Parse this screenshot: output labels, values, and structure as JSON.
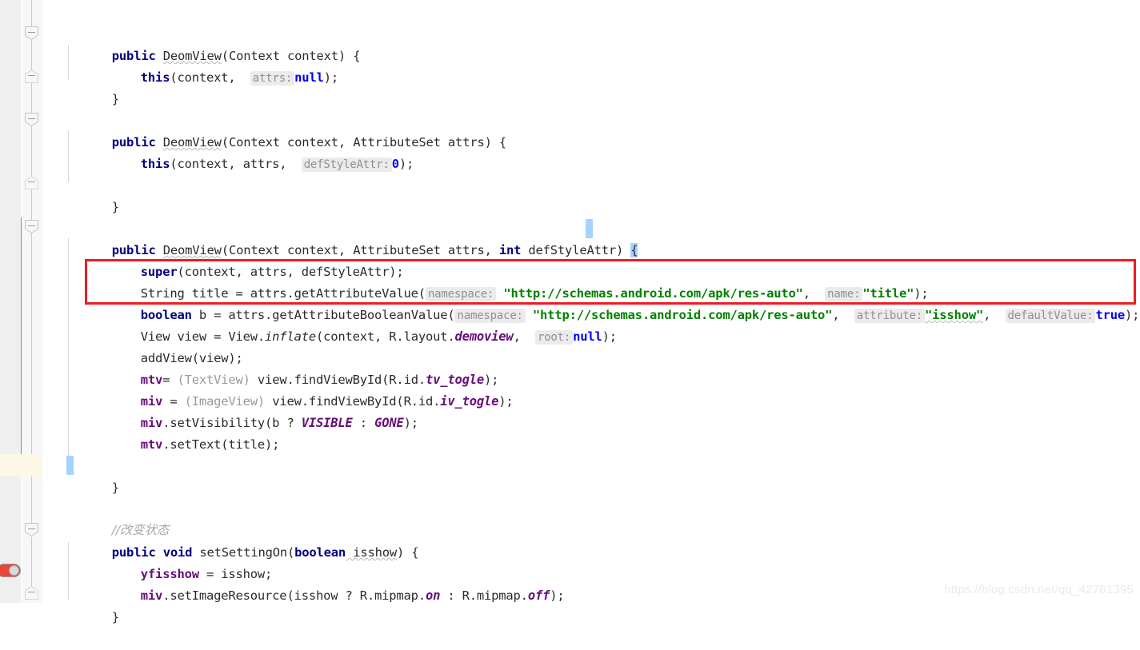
{
  "editor": {
    "language": "java",
    "theme": "light",
    "watermark": "https://blog.csdn.net/qq_42761395",
    "colors": {
      "gutter_bg": "#efefef",
      "code_bg": "#ffffff",
      "caret_row_bg": "#fdf8e6",
      "selection_bg": "#a6d2ff",
      "vcs_change_marker": "#6897bb",
      "annotation_box": "#ed1c24",
      "keyword": "#000080",
      "string": "#008000",
      "number": "#0000ff",
      "field": "#660e7a",
      "comment": "#a8a8a8",
      "param_hint": "#909090",
      "watermark": "#eaeaea"
    },
    "annotation": {
      "name": "red-highlight-rectangle",
      "covers_lines": [
        "String title = attrs.getAttributeValue(namespace: \"http://schemas.android.com/apk/res-auto\", name: \"title\");",
        "boolean b = attrs.getAttributeBooleanValue(namespace: \"http://schemas.android.com/apk/res-auto\", attribute: \"isshow\", defaultValue: true);"
      ]
    },
    "gutter": {
      "toggle_icon_label": "on-off-toggle-icon",
      "fold_markers": 7
    }
  },
  "code": {
    "line01": "public DeomView(Context context) {",
    "line02": "    this(context,  attrs: null);",
    "line03": "}",
    "line05": "public DeomView(Context context, AttributeSet attrs) {",
    "line06": "    this(context, attrs,  defStyleAttr: 0);",
    "line08": "}",
    "line10": "public DeomView(Context context, AttributeSet attrs, int defStyleAttr) {",
    "line11": "    super(context, attrs, defStyleAttr);",
    "line12": "    String title = attrs.getAttributeValue( namespace: \"http://schemas.android.com/apk/res-auto\",  name: \"title\");",
    "line13": "    boolean b = attrs.getAttributeBooleanValue( namespace: \"http://schemas.android.com/apk/res-auto\",  attribute: \"isshow\",  defaultValue: true);",
    "line14": "    View view = View.inflate(context, R.layout.demoview,  root: null);",
    "line15": "    addView(view);",
    "line16": "    mtv= (TextView) view.findViewById(R.id.tv_togle);",
    "line17": "    miv = (ImageView) view.findViewById(R.id.iv_togle);",
    "line18": "    miv.setVisibility(b ? VISIBLE : GONE);",
    "line19": "    mtv.setText(title);",
    "line21": "}",
    "line23": "//改变状态",
    "line24": "public void setSettingOn(boolean isshow) {",
    "line25": "    yfisshow = isshow;",
    "line26": "    miv.setImageResource(isshow ? R.mipmap.on : R.mipmap.off);",
    "line27": "}"
  },
  "tokens": {
    "kw_public": "public",
    "kw_this": "this",
    "kw_super": "super",
    "kw_int": "int",
    "kw_void": "void",
    "kw_boolean": "boolean",
    "kw_null": "null",
    "kw_true": "true",
    "type_Context": "Context",
    "type_AttributeSet": "AttributeSet",
    "type_String": "String",
    "type_View": "View",
    "type_TextView": "(TextView)",
    "type_ImageView": "(ImageView)",
    "ctor_name": "DeomView",
    "url_namespace": "\"http://schemas.android.com/apk/res-auto\"",
    "name_title": "\"title\"",
    "name_isshow": "\"isshow\"",
    "hint_attrs": "attrs:",
    "hint_defStyleAttr": "defStyleAttr:",
    "hint_namespace": "namespace:",
    "hint_name": "name:",
    "hint_attribute": "attribute:",
    "hint_defaultValue": "defaultValue:",
    "hint_root": "root:",
    "field_mtv": "mtv",
    "field_miv": "miv",
    "field_yfisshow": "yfisshow",
    "static_demoview": "demoview",
    "static_tv_togle": "tv_togle",
    "static_iv_togle": "iv_togle",
    "static_VISIBLE": "VISIBLE",
    "static_GONE": "GONE",
    "static_on": "on",
    "static_off": "off",
    "comment_change_state": "//改变状态",
    "method_setSettingOn": "setSettingOn",
    "method_inflate": "inflate"
  }
}
